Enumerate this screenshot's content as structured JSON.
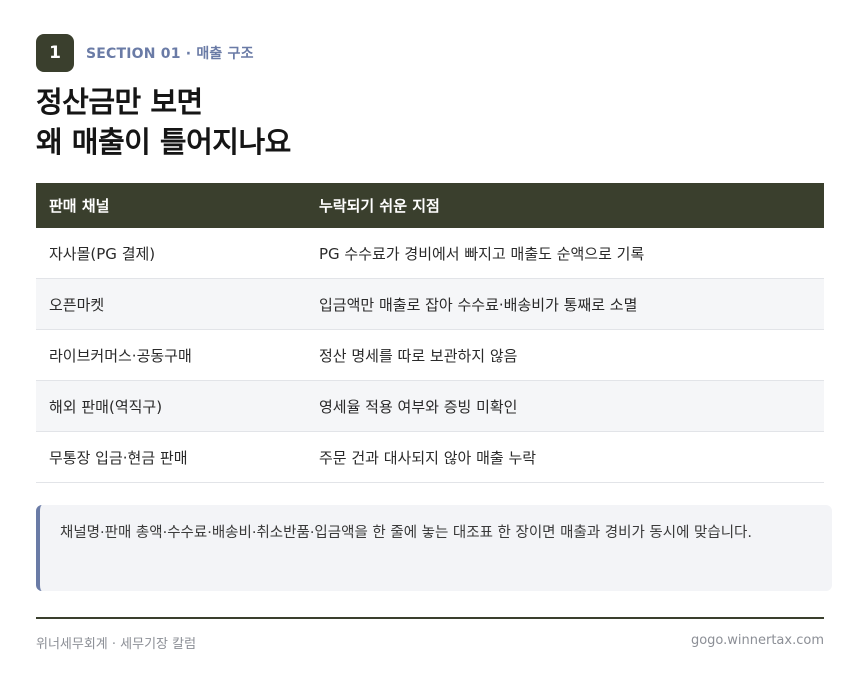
{
  "section": {
    "number": "1",
    "label": "SECTION 01 · 매출 구조"
  },
  "title": {
    "line1": "정산금만 보면",
    "line2": "왜 매출이 틀어지나요"
  },
  "table": {
    "headers": [
      "판매 채널",
      "누락되기 쉬운 지점"
    ],
    "rows": [
      [
        "자사몰(PG 결제)",
        "PG 수수료가 경비에서 빠지고 매출도 순액으로 기록"
      ],
      [
        "오픈마켓",
        "입금액만 매출로 잡아 수수료·배송비가 통째로 소멸"
      ],
      [
        "라이브커머스·공동구매",
        "정산 명세를 따로 보관하지 않음"
      ],
      [
        "해외 판매(역직구)",
        "영세율 적용 여부와 증빙 미확인"
      ],
      [
        "무통장 입금·현금 판매",
        "주문 건과 대사되지 않아 매출 누락"
      ]
    ]
  },
  "note": "채널명·판매 총액·수수료·배송비·취소반품·입금액을 한 줄에 놓는 대조표 한 장이면 매출과 경비가 동시에 맞습니다.",
  "footer": {
    "left": "위너세무회계 · 세무기장 칼럼",
    "right": "gogo.winnertax.com"
  },
  "colors": {
    "header_bg": "#3a3f2d",
    "accent": "#6a7ba6",
    "alt_row": "#f5f6f8"
  }
}
